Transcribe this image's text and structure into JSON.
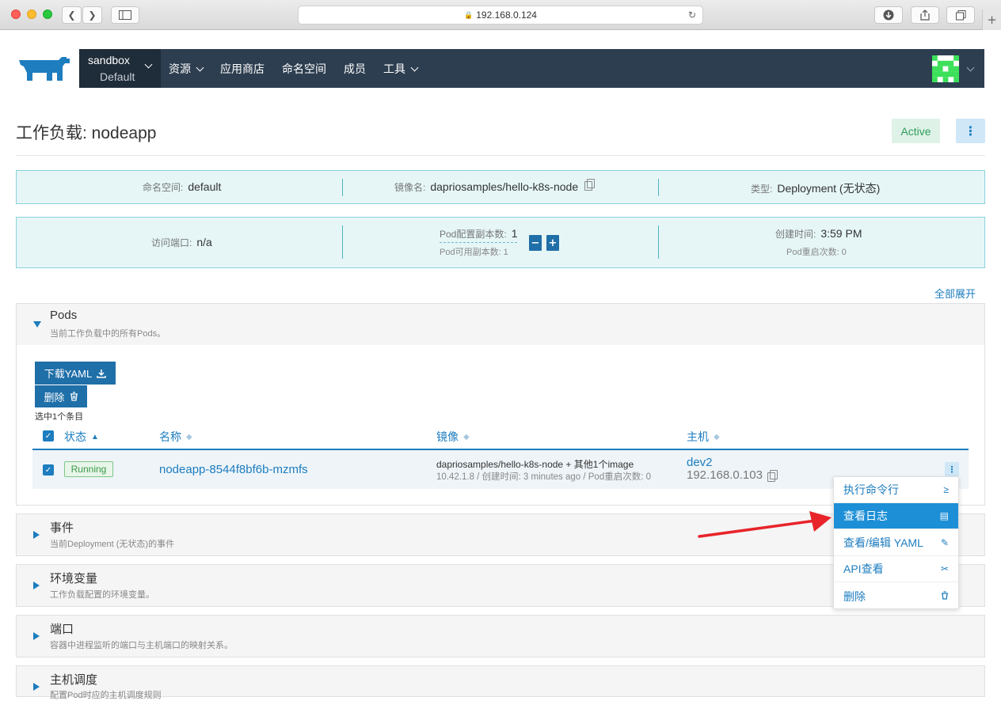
{
  "browser": {
    "url": "192.168.0.124"
  },
  "nav": {
    "project_name": "sandbox",
    "project_sub": "Default",
    "items": [
      {
        "label": "资源",
        "dropdown": true
      },
      {
        "label": "应用商店",
        "dropdown": false
      },
      {
        "label": "命名空间",
        "dropdown": false
      },
      {
        "label": "成员",
        "dropdown": false
      },
      {
        "label": "工具",
        "dropdown": true
      }
    ]
  },
  "header": {
    "title": "工作负载: nodeapp",
    "status": "Active"
  },
  "info": {
    "namespace_label": "命名空间:",
    "namespace_value": "default",
    "image_label": "镜像名:",
    "image_value": "dapriosamples/hello-k8s-node",
    "type_label": "类型:",
    "type_value": "Deployment (无状态)",
    "port_label": "访问端口:",
    "port_value": "n/a",
    "replicas_label": "Pod配置副本数:",
    "replicas_value": "1",
    "available_label": "Pod可用副本数: 1",
    "created_label": "创建时间:",
    "created_value": "3:59 PM",
    "restarts_label": "Pod重启次数: 0",
    "minus": "−",
    "plus": "+"
  },
  "expand_all": "全部展开",
  "pods": {
    "title": "Pods",
    "subtitle": "当前工作负载中的所有Pods。",
    "download_label": "下载YAML",
    "delete_label": "删除",
    "selected_text": "选中1个条目",
    "columns": [
      "状态",
      "名称",
      "镜像",
      "主机"
    ],
    "row": {
      "status": "Running",
      "name": "nodeapp-8544f8bf6b-mzmfs",
      "image_line1": "dapriosamples/hello-k8s-node + 其他1个image",
      "image_line2": "10.42.1.8 / 创建时间: 3 minutes ago / Pod重启次数: 0",
      "host_name": "dev2",
      "host_ip": "192.168.0.103"
    }
  },
  "menu": {
    "items": [
      {
        "label": "执行命令行",
        "icon": "≥"
      },
      {
        "label": "查看日志",
        "icon": "▤"
      },
      {
        "label": "查看/编辑 YAML",
        "icon": "✎"
      },
      {
        "label": "API查看",
        "icon": "✂"
      },
      {
        "label": "删除",
        "icon": "🗑"
      }
    ],
    "highlight_index": 1
  },
  "sections": [
    {
      "title": "事件",
      "subtitle": "当前Deployment (无状态)的事件"
    },
    {
      "title": "环境变量",
      "subtitle": "工作负载配置的环境变量。"
    },
    {
      "title": "端口",
      "subtitle": "容器中进程监听的端口与主机端口的映射关系。"
    },
    {
      "title": "主机调度",
      "subtitle": "配置Pod时应的主机调度规则"
    }
  ],
  "colors": {
    "accent": "#1d7dbf",
    "nav_bg": "#2d3e50",
    "arrow": "#e8232a"
  }
}
